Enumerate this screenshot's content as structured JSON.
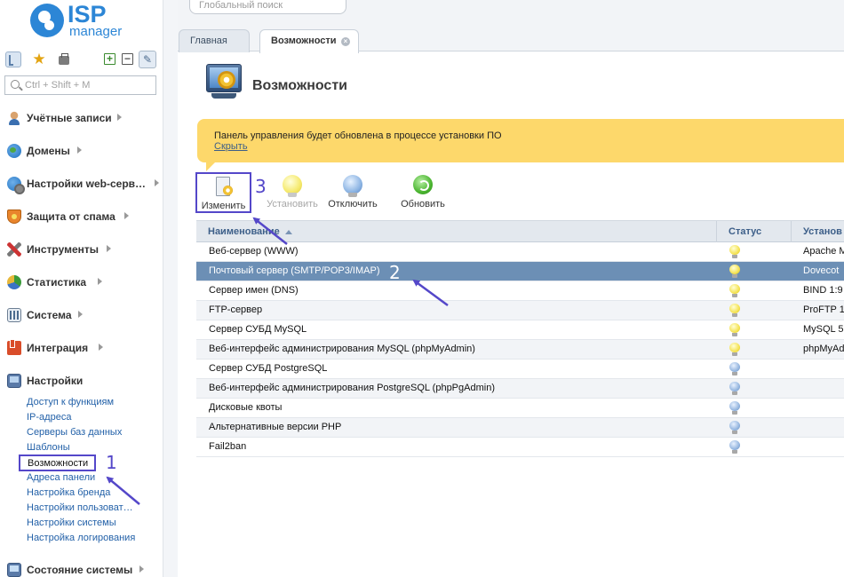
{
  "logo": {
    "brand": "ISP",
    "product": "manager"
  },
  "sidebar": {
    "search_placeholder": "Ctrl + Shift + M",
    "menu": [
      {
        "label": "Учётные записи",
        "icon": "user-accounts-icon"
      },
      {
        "label": "Домены",
        "icon": "globe-icon"
      },
      {
        "label": "Настройки web-серв…",
        "icon": "web-settings-icon"
      },
      {
        "label": "Защита от спама",
        "icon": "spam-shield-icon"
      },
      {
        "label": "Инструменты",
        "icon": "tools-icon"
      },
      {
        "label": "Статистика",
        "icon": "pie-chart-icon"
      },
      {
        "label": "Система",
        "icon": "system-icon"
      },
      {
        "label": "Интеграция",
        "icon": "integration-icon"
      },
      {
        "label": "Настройки",
        "icon": "settings-icon"
      },
      {
        "label": "Состояние системы",
        "icon": "system-state-icon"
      }
    ],
    "submenu": [
      "Доступ к функциям",
      "IP-адреса",
      "Серверы баз данных",
      "Шаблоны",
      "Возможности",
      "Адреса панели",
      "Настройка бренда",
      "Настройки пользоват…",
      "Настройки системы",
      "Настройка логирования"
    ]
  },
  "header": {
    "global_search_placeholder": "Глобальный поиск",
    "tabs": [
      {
        "label": "Главная"
      },
      {
        "label": "Возможности"
      }
    ]
  },
  "page": {
    "title": "Возможности",
    "notice_text": "Панель управления будет обновлена в процессе установки ПО",
    "notice_link": "Скрыть"
  },
  "toolbar": {
    "edit": "Изменить",
    "install": "Установить",
    "disable": "Отключить",
    "refresh": "Обновить"
  },
  "annotations": {
    "one": "1",
    "two": "2",
    "three": "3"
  },
  "grid": {
    "headers": {
      "name": "Наименование",
      "status": "Статус",
      "installed": "Установ"
    },
    "rows": [
      {
        "name": "Веб-сервер (WWW)",
        "status": "on",
        "installed": "Apache M"
      },
      {
        "name": "Почтовый сервер (SMTP/POP3/IMAP)",
        "status": "on",
        "installed": "Dovecot"
      },
      {
        "name": "Сервер имен (DNS)",
        "status": "on",
        "installed": "BIND 1:9"
      },
      {
        "name": "FTP-сервер",
        "status": "on",
        "installed": "ProFTP 1"
      },
      {
        "name": "Сервер СУБД MySQL",
        "status": "on",
        "installed": "MySQL 5"
      },
      {
        "name": "Веб-интерфейс администрирования MySQL (phpMyAdmin)",
        "status": "on",
        "installed": "phpMyAd"
      },
      {
        "name": "Сервер СУБД PostgreSQL",
        "status": "off",
        "installed": ""
      },
      {
        "name": "Веб-интерфейс администрирования PostgreSQL (phpPgAdmin)",
        "status": "off",
        "installed": ""
      },
      {
        "name": "Дисковые квоты",
        "status": "off",
        "installed": ""
      },
      {
        "name": "Альтернативные версии PHP",
        "status": "off",
        "installed": ""
      },
      {
        "name": "Fail2ban",
        "status": "off",
        "installed": ""
      }
    ]
  },
  "colors": {
    "accent": "#2c86d6",
    "annotation": "#5447c9",
    "notice_bg": "#fdd86b",
    "selected_row": "#6c8fb5"
  }
}
